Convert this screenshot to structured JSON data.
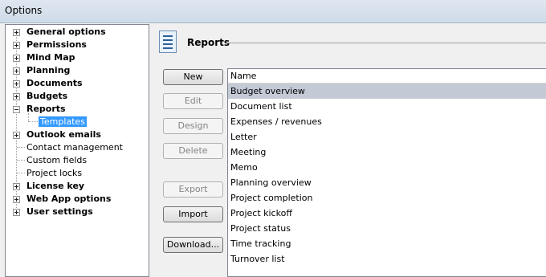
{
  "window": {
    "title": "Options"
  },
  "tree": {
    "items": [
      {
        "label": "General options"
      },
      {
        "label": "Permissions"
      },
      {
        "label": "Mind Map"
      },
      {
        "label": "Planning"
      },
      {
        "label": "Documents"
      },
      {
        "label": "Budgets"
      },
      {
        "label": "Reports"
      },
      {
        "label": "Templates"
      },
      {
        "label": "Outlook emails"
      },
      {
        "label": "Contact management"
      },
      {
        "label": "Custom fields"
      },
      {
        "label": "Project locks"
      },
      {
        "label": "License key"
      },
      {
        "label": "Web App options"
      },
      {
        "label": "User settings"
      }
    ],
    "selected": "Templates"
  },
  "section": {
    "title": "Reports",
    "icon": "report-document-icon"
  },
  "buttons": {
    "new": "New",
    "edit": "Edit",
    "design": "Design",
    "delete": "Delete",
    "export": "Export",
    "import": "Import",
    "download": "Download..."
  },
  "list": {
    "header": "Name",
    "rows": [
      "Budget overview",
      "Document list",
      "Expenses / revenues",
      "Letter",
      "Meeting",
      "Memo",
      "Planning overview",
      "Project completion",
      "Project kickoff",
      "Project status",
      "Time tracking",
      "Turnover list"
    ],
    "selected": "Budget overview"
  },
  "colors": {
    "selection": "#3399ff",
    "list_selection": "#c3cad6"
  }
}
